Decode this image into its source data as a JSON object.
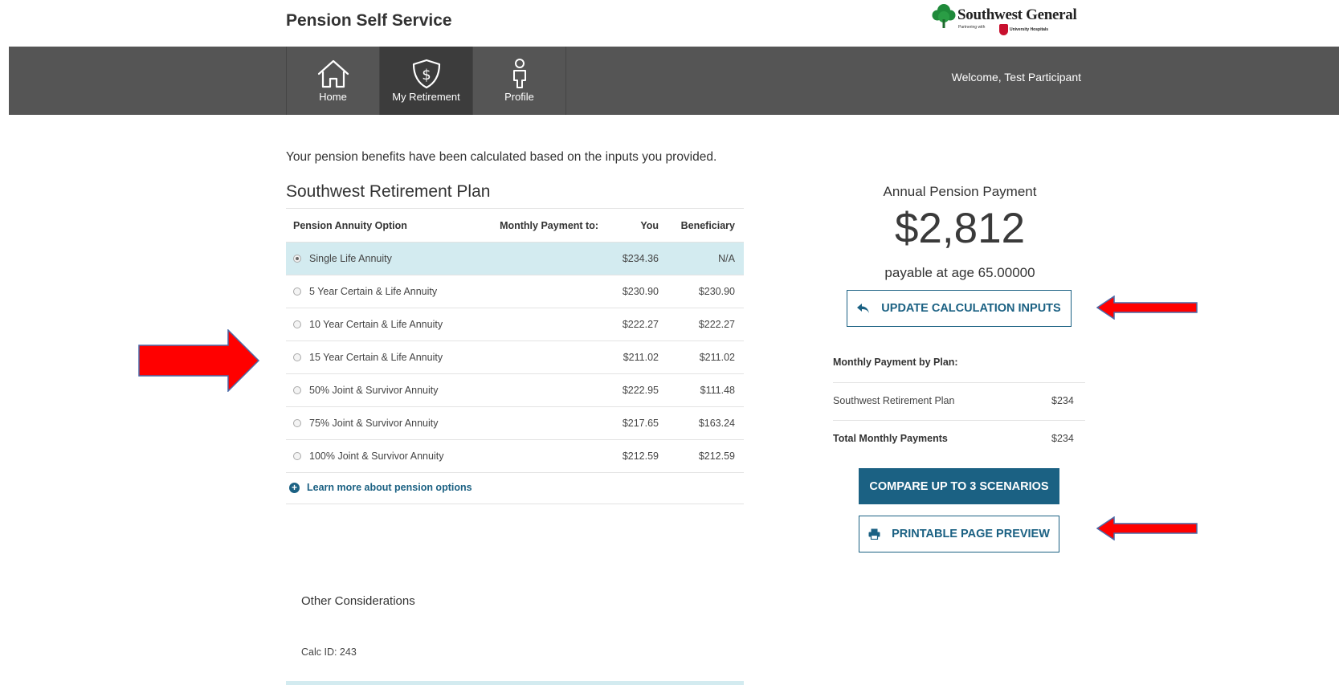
{
  "header": {
    "app_title": "Pension Self Service",
    "logo_name": "Southwest General",
    "logo_partner": "Partnering with",
    "logo_partner_org": "University Hospitals"
  },
  "nav": {
    "items": [
      {
        "label": "Home",
        "icon": "home-icon",
        "active": false
      },
      {
        "label": "My Retirement",
        "icon": "shield-dollar-icon",
        "active": true
      },
      {
        "label": "Profile",
        "icon": "person-icon",
        "active": false
      }
    ],
    "welcome": "Welcome, Test Participant"
  },
  "main": {
    "intro": "Your pension benefits have been calculated based on the inputs you provided.",
    "plan_title": "Southwest Retirement Plan",
    "table": {
      "headers": {
        "option": "Pension Annuity Option",
        "monthly": "Monthly Payment to:",
        "you": "You",
        "beneficiary": "Beneficiary"
      },
      "rows": [
        {
          "option": "Single Life Annuity",
          "you": "$234.36",
          "beneficiary": "N/A",
          "selected": true
        },
        {
          "option": "5 Year Certain & Life Annuity",
          "you": "$230.90",
          "beneficiary": "$230.90",
          "selected": false
        },
        {
          "option": "10 Year Certain & Life Annuity",
          "you": "$222.27",
          "beneficiary": "$222.27",
          "selected": false
        },
        {
          "option": "15 Year Certain & Life Annuity",
          "you": "$211.02",
          "beneficiary": "$211.02",
          "selected": false
        },
        {
          "option": "50% Joint & Survivor Annuity",
          "you": "$222.95",
          "beneficiary": "$111.48",
          "selected": false
        },
        {
          "option": "75% Joint & Survivor Annuity",
          "you": "$217.65",
          "beneficiary": "$163.24",
          "selected": false
        },
        {
          "option": "100% Joint & Survivor Annuity",
          "you": "$212.59",
          "beneficiary": "$212.59",
          "selected": false
        }
      ]
    },
    "learn_more": "Learn more about pension options",
    "other_title": "Other Considerations",
    "calc_id": "Calc ID: 243"
  },
  "summary": {
    "annual_label": "Annual Pension Payment",
    "annual_amount": "$2,812",
    "payable": "payable at age 65.00000",
    "update_button": "UPDATE CALCULATION INPUTS",
    "monthly_title": "Monthly Payment by Plan:",
    "plan_name": "Southwest Retirement Plan",
    "plan_value": "$234",
    "total_label": "Total Monthly Payments",
    "total_value": "$234",
    "compare_button": "COMPARE UP TO 3 SCENARIOS",
    "print_button": "PRINTABLE PAGE PREVIEW"
  },
  "colors": {
    "navbar": "#555555",
    "accent": "#1b6183",
    "selected_row": "#d3ebf0",
    "annotation_arrow": "#ff0000"
  }
}
